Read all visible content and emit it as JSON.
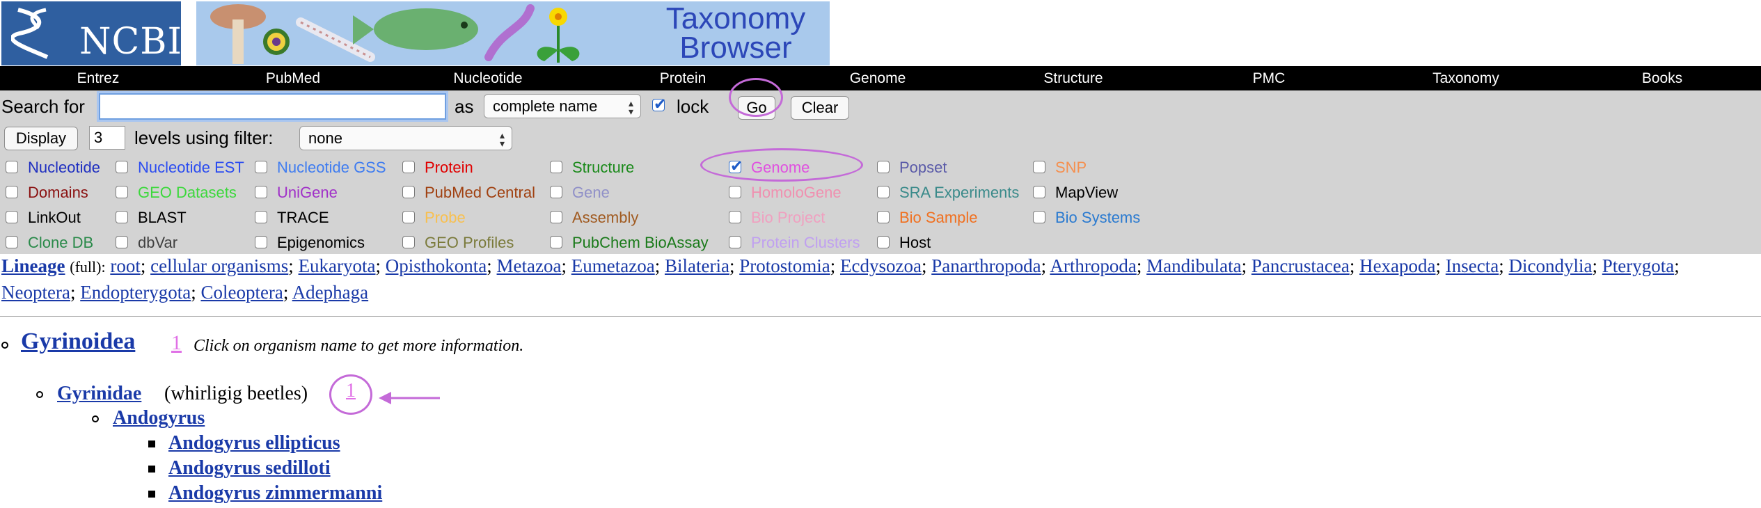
{
  "header": {
    "logo_text": "NCBI",
    "title_line1": "Taxonomy",
    "title_line2": "Browser"
  },
  "nav": [
    {
      "label": "Entrez"
    },
    {
      "label": "PubMed"
    },
    {
      "label": "Nucleotide"
    },
    {
      "label": "Protein"
    },
    {
      "label": "Genome"
    },
    {
      "label": "Structure"
    },
    {
      "label": "PMC"
    },
    {
      "label": "Taxonomy"
    },
    {
      "label": "Books"
    }
  ],
  "search": {
    "label": "Search for",
    "value": "",
    "as_label": "as",
    "as_value": "complete name",
    "lock_label": "lock",
    "lock_checked": true,
    "go": "Go",
    "clear": "Clear"
  },
  "display": {
    "button": "Display",
    "levels_value": "3",
    "levels_label": "levels using filter:",
    "filter_value": "none"
  },
  "databases": [
    [
      {
        "label": "Nucleotide",
        "color": "#1f2fc0"
      },
      {
        "label": "Nucleotide EST",
        "color": "#2b4cf0"
      },
      {
        "label": "Nucleotide GSS",
        "color": "#3f7cf0"
      },
      {
        "label": "Protein",
        "color": "#e00000"
      },
      {
        "label": "Structure",
        "color": "#1b8a1b"
      },
      {
        "label": "Genome",
        "color": "#e050e0",
        "checked": true
      },
      {
        "label": "Popset",
        "color": "#5a5aa8"
      },
      {
        "label": "SNP",
        "color": "#f59050"
      }
    ],
    [
      {
        "label": "Domains",
        "color": "#8a1010"
      },
      {
        "label": "GEO Datasets",
        "color": "#3cd83c"
      },
      {
        "label": "UniGene",
        "color": "#a030c8"
      },
      {
        "label": "PubMed Central",
        "color": "#a04010"
      },
      {
        "label": "Gene",
        "color": "#9090c8"
      },
      {
        "label": "HomoloGene",
        "color": "#f090b0"
      },
      {
        "label": "SRA Experiments",
        "color": "#3a8a8a"
      },
      {
        "label": "MapView",
        "color": "#000000"
      }
    ],
    [
      {
        "label": "LinkOut",
        "color": "#000000"
      },
      {
        "label": "BLAST",
        "color": "#000000"
      },
      {
        "label": "TRACE",
        "color": "#000000"
      },
      {
        "label": "Probe",
        "color": "#f8c050"
      },
      {
        "label": "Assembly",
        "color": "#a05a20"
      },
      {
        "label": "Bio Project",
        "color": "#f0a0c0"
      },
      {
        "label": "Bio Sample",
        "color": "#f07020"
      },
      {
        "label": "Bio Systems",
        "color": "#2a7ad0"
      }
    ],
    [
      {
        "label": "Clone DB",
        "color": "#2a8a4a"
      },
      {
        "label": "dbVar",
        "color": "#404040"
      },
      {
        "label": "Epigenomics",
        "color": "#000000"
      },
      {
        "label": "GEO Profiles",
        "color": "#7a7a3a"
      },
      {
        "label": "PubChem BioAssay",
        "color": "#1a7a1a"
      },
      {
        "label": "Protein Clusters",
        "color": "#c0a0f0"
      },
      {
        "label": "Host",
        "color": "#000000"
      }
    ]
  ],
  "lineage": {
    "label": "Lineage",
    "full": "(full):",
    "taxa": [
      "root",
      "cellular organisms",
      "Eukaryota",
      "Opisthokonta",
      "Metazoa",
      "Eumetazoa",
      "Bilateria",
      "Protostomia",
      "Ecdysozoa",
      "Panarthropoda",
      "Arthropoda",
      "Mandibulata",
      "Pancrustacea",
      "Hexapoda",
      "Insecta",
      "Dicondylia",
      "Pterygota",
      "Neoptera",
      "Endopterygota",
      "Coleoptera",
      "Adephaga"
    ]
  },
  "tree": {
    "root_name": "Gyrinoidea",
    "root_count": "1",
    "hint": "Click on organism name to get more information.",
    "family": "Gyrinidae",
    "family_common": "(whirligig beetles)",
    "family_count": "1",
    "genus": "Andogyrus",
    "species": [
      "Andogyrus ellipticus",
      "Andogyrus sedilloti",
      "Andogyrus zimmermanni"
    ]
  },
  "colors": {
    "annotation": "#c46ad8",
    "link": "#1a3aa8",
    "count_link": "#e070e6"
  }
}
